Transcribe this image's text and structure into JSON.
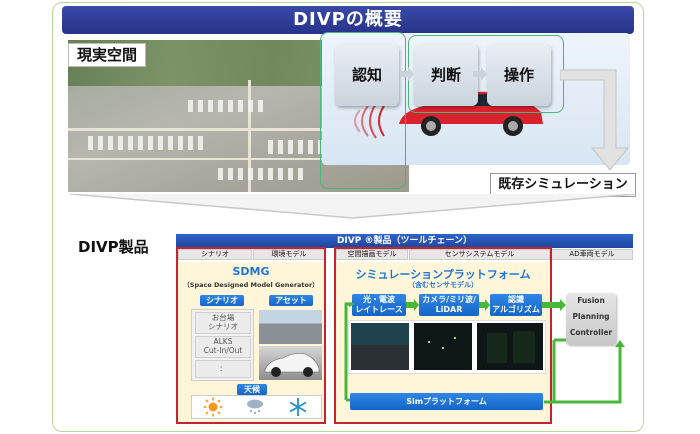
{
  "title": "DIVPの概要",
  "real_space_label": "現実空間",
  "process_steps": [
    "認知",
    "判断",
    "操作"
  ],
  "existing_sim_label": "既存シミュレーション",
  "product_label": "DIVP製品",
  "toolchain_header": "DIVP ®製品（ツールチェーン）",
  "toolchain_tabs": [
    "シナリオ",
    "環境モデル",
    "空間描画モデル",
    "センサシステムモデル",
    "AD車両モデル"
  ],
  "sdmg": {
    "title": "SDMG",
    "subtitle": "（Space Designed Model Generator）",
    "scenario_button": "シナリオ",
    "asset_button": "アセット",
    "scenario_items": [
      "お台場\nシナリオ",
      "ALKS\nCut-In/Out",
      "："
    ],
    "weather_button": "天候",
    "weather_icons": [
      "sun-icon",
      "snow-cloud-icon",
      "snowflake-icon"
    ]
  },
  "platform": {
    "title": "シミュレーションプラットフォーム",
    "subtitle": "（含むセンサモデル）",
    "blocks": [
      "光・電波\nレイトレース",
      "カメラ/ミリ波/\nLiDAR",
      "認識\nアルゴリズム"
    ],
    "sim_platform": "Simプラットフォーム"
  },
  "fpc": [
    "Fusion",
    "Planning",
    "Controller"
  ],
  "colors": {
    "title_bar": "#2f3d9a",
    "green_frame": "#4bb57a",
    "red_frame": "#c8222c",
    "blue_block": "#1f74d8",
    "flow_arrow": "#49b83a"
  }
}
